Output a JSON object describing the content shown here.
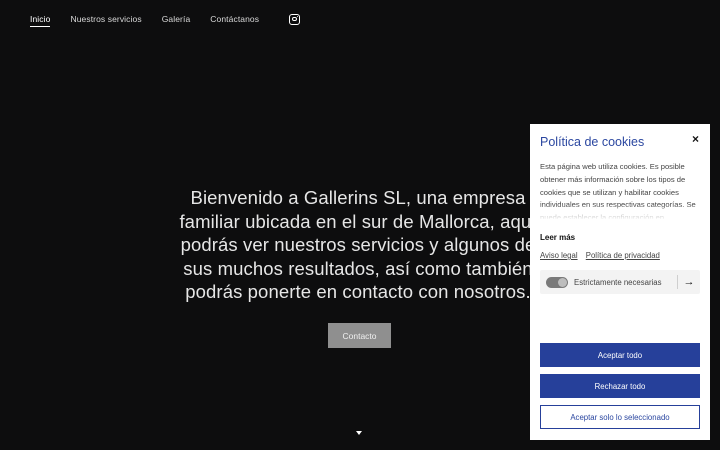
{
  "nav": {
    "items": [
      {
        "label": "Inicio"
      },
      {
        "label": "Nuestros servicios"
      },
      {
        "label": "Galería"
      },
      {
        "label": "Contáctanos"
      }
    ]
  },
  "hero": {
    "lines": [
      "Bienvenido a Gallerins SL, una empresa",
      "familiar ubicada en el sur de Mallorca, aquí",
      "podrás ver nuestros servicios y algunos de",
      "sus muchos resultados, así como también",
      "podrás ponerte en contacto con nosotros."
    ],
    "button_label": "Contacto"
  },
  "cookie": {
    "title": "Política de cookies",
    "close": "×",
    "text": "Esta página web utiliza cookies. Es posible obtener más información sobre los tipos de cookies que se utilizan y habilitar cookies individuales en sus respectivas categorías. Se puede establecer la configuración en",
    "read_more": "Leer más",
    "link_legal": "Aviso legal",
    "link_privacy": "Política de privacidad",
    "necessary_label": "Estrictamente necesarias",
    "necessary_arrow": "→",
    "accept_all": "Aceptar todo",
    "reject_all": "Rechazar todo",
    "accept_selected": "Aceptar solo lo seleccionado"
  },
  "colors": {
    "background": "#0d0d0e",
    "accent": "#26409a",
    "button_grey": "#8f8f8f"
  }
}
